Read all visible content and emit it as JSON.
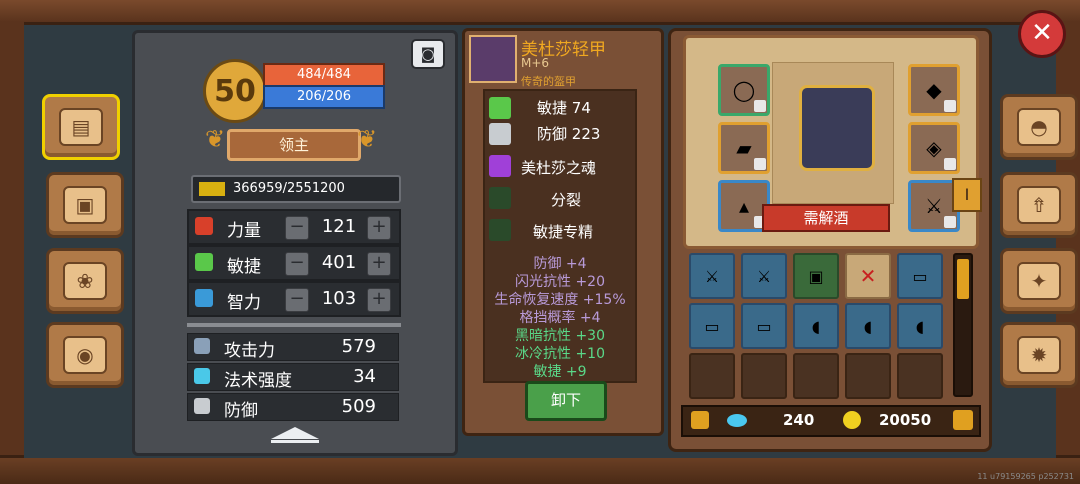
{
  "level": "50",
  "hp": "484/484",
  "mp": "206/206",
  "title": "领主",
  "exp": "366959/2551200",
  "core_stats": [
    {
      "name": "力量",
      "value": "121",
      "color": "#d8402a"
    },
    {
      "name": "敏捷",
      "value": "401",
      "color": "#5ac84a"
    },
    {
      "name": "智力",
      "value": "103",
      "color": "#3a9ad8"
    }
  ],
  "attributes": [
    {
      "name": "攻击力",
      "value": "579"
    },
    {
      "name": "法术强度",
      "value": "34"
    },
    {
      "name": "防御",
      "value": "509"
    }
  ],
  "item": {
    "name": "美杜莎轻甲",
    "sub": "M+6",
    "quality": "传奇的盔甲",
    "base": [
      {
        "label": "敏捷",
        "value": "74"
      },
      {
        "label": "防御",
        "value": "223"
      }
    ],
    "traits": [
      "美杜莎之魂",
      "分裂",
      "敏捷专精"
    ],
    "bonuses": [
      {
        "text": "防御 +4",
        "color": "#b89ad8"
      },
      {
        "text": "闪光抗性 +20",
        "color": "#b89ad8"
      },
      {
        "text": "生命恢复速度 +15%",
        "color": "#b89ad8"
      },
      {
        "text": "格挡概率 +4",
        "color": "#b89ad8"
      },
      {
        "text": "黑暗抗性 +30",
        "color": "#5ad888"
      },
      {
        "text": "冰冷抗性 +10",
        "color": "#5ad888"
      },
      {
        "text": "敏捷 +9",
        "color": "#5ad888"
      }
    ],
    "unequip_label": "卸下"
  },
  "need_label": "需解酒",
  "tab_marker": "I",
  "gems": "240",
  "coins": "20050",
  "watermark": "11 u79159265 p252731"
}
